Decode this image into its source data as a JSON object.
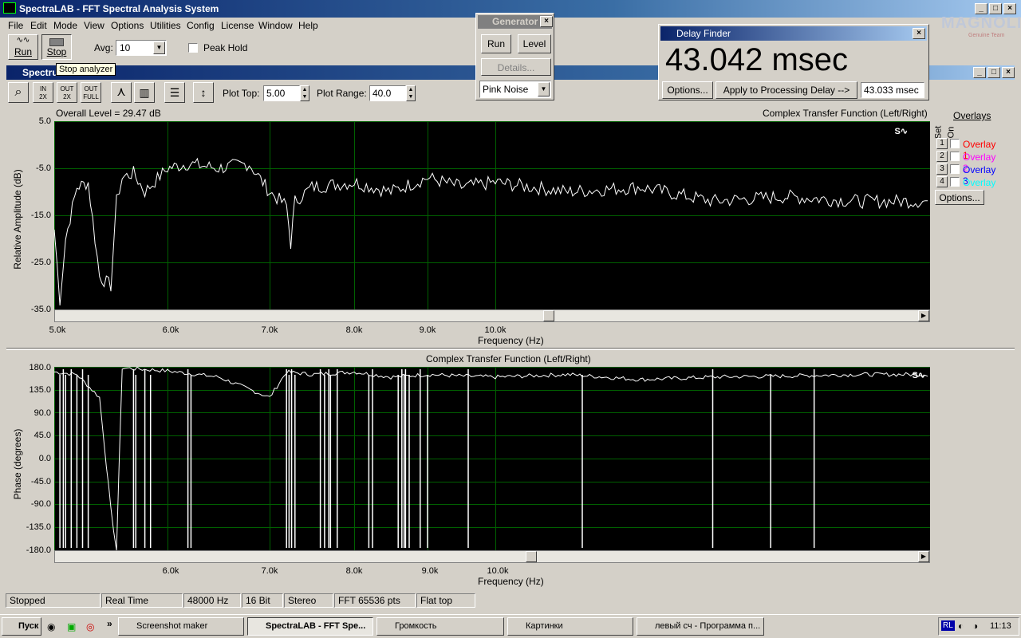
{
  "window": {
    "title": "SpectraLAB - FFT Spectral Analysis System",
    "inner_title": "Spectru"
  },
  "menu": [
    "File",
    "Edit",
    "Mode",
    "View",
    "Options",
    "Utilities",
    "Config",
    "License",
    "Window",
    "Help"
  ],
  "toolbar": {
    "run_label": "Run",
    "stop_label": "Stop",
    "avg_label": "Avg:",
    "avg_value": "10",
    "peak_hold_label": "Peak Hold",
    "tooltip": "Stop analyzer"
  },
  "plot_toolbar": {
    "plot_top_label": "Plot Top:",
    "plot_top_value": "5.00",
    "plot_range_label": "Plot Range:",
    "plot_range_value": "40.0"
  },
  "generator": {
    "title": "Generator",
    "run_label": "Run",
    "level_label": "Level",
    "details_label": "Details...",
    "noise_value": "Pink Noise"
  },
  "delay_finder": {
    "title": "Delay Finder",
    "value": "43.042 msec",
    "options_label": "Options...",
    "apply_label": "Apply to Processing Delay -->",
    "field_value": "43.033 msec"
  },
  "watermark": {
    "text": "MAGNOLIA",
    "sub": "Genuine Team"
  },
  "top_plot": {
    "left_header": "Overall Level = 29.47 dB",
    "right_header": "Complex Transfer Function (Left/Right)",
    "ylabel": "Relative Amplitude (dB)",
    "xlabel": "Frequency (Hz)",
    "yticks": [
      "5.0",
      "-5.0",
      "-15.0",
      "-25.0",
      "-35.0"
    ],
    "xticks": [
      "5.0k",
      "6.0k",
      "7.0k",
      "8.0k",
      "9.0k",
      "10.0k"
    ]
  },
  "bottom_plot": {
    "header": "Complex Transfer Function (Left/Right)",
    "ylabel": "Phase (degrees)",
    "xlabel": "Frequency (Hz)",
    "yticks": [
      "180.0",
      "135.0",
      "90.0",
      "45.0",
      "0.0",
      "-45.0",
      "-90.0",
      "-135.0",
      "-180.0"
    ],
    "xticks": [
      "6.0k",
      "7.0k",
      "8.0k",
      "9.0k",
      "10.0k"
    ]
  },
  "overlays": {
    "title": "Overlays",
    "set_label": "Set",
    "on_label": "On",
    "options_label": "Options...",
    "items": [
      {
        "num": "1",
        "label": "Overlay 1",
        "color": "#ff0000"
      },
      {
        "num": "2",
        "label": "Overlay 2",
        "color": "#ff00ff"
      },
      {
        "num": "3",
        "label": "Overlay 3",
        "color": "#0000ff"
      },
      {
        "num": "4",
        "label": "Overlay 4",
        "color": "#00ffff"
      }
    ]
  },
  "status": [
    "Stopped",
    "Real Time",
    "48000 Hz",
    "16 Bit",
    "Stereo",
    "FFT 65536 pts",
    "Flat top"
  ],
  "taskbar": {
    "start_label": "Пуск",
    "items": [
      "Screenshot maker",
      "SpectraLAB - FFT Spe...",
      "Громкость",
      "Картинки",
      "левый сч - Программа п..."
    ],
    "lang": "RL",
    "clock": "11:13"
  },
  "chart_data": [
    {
      "type": "line",
      "title": "Complex Transfer Function (Left/Right)",
      "xlabel": "Frequency (Hz)",
      "ylabel": "Relative Amplitude (dB)",
      "ylim": [
        -35,
        5
      ],
      "xlim": [
        5000,
        13000
      ],
      "grid": true,
      "x": [
        5000,
        5050,
        5100,
        5200,
        5300,
        5400,
        5500,
        5550,
        5600,
        5700,
        5800,
        6000,
        6200,
        6500,
        6800,
        7000,
        7200,
        7250,
        7300,
        7500,
        8000,
        8500,
        9000,
        9500,
        10000,
        10500,
        11000,
        11500,
        12000,
        12500,
        13000
      ],
      "values": [
        -18,
        -33,
        -20,
        -9,
        -8,
        -28,
        -30,
        -12,
        -7,
        -6,
        -10,
        -5,
        -4,
        -5,
        -4,
        -10,
        -13,
        -21,
        -12,
        -9,
        -8,
        -10,
        -7,
        -9,
        -8,
        -10,
        -9,
        -12,
        -11,
        -12,
        -12
      ]
    },
    {
      "type": "line",
      "title": "Complex Transfer Function (Left/Right)",
      "xlabel": "Frequency (Hz)",
      "ylabel": "Phase (degrees)",
      "ylim": [
        -180,
        180
      ],
      "xlim": [
        5000,
        13000
      ],
      "grid": true,
      "x": [
        5000,
        5200,
        5400,
        5500,
        5550,
        5600,
        5800,
        6000,
        6500,
        7000,
        7200,
        7500,
        8000,
        8500,
        9000,
        9500,
        10000,
        10500,
        11000,
        11500,
        12000,
        12500,
        13000
      ],
      "values": [
        170,
        165,
        120,
        -100,
        -180,
        178,
        175,
        172,
        160,
        120,
        170,
        165,
        170,
        160,
        165,
        162,
        160,
        165,
        155,
        160,
        162,
        165,
        165
      ]
    }
  ]
}
